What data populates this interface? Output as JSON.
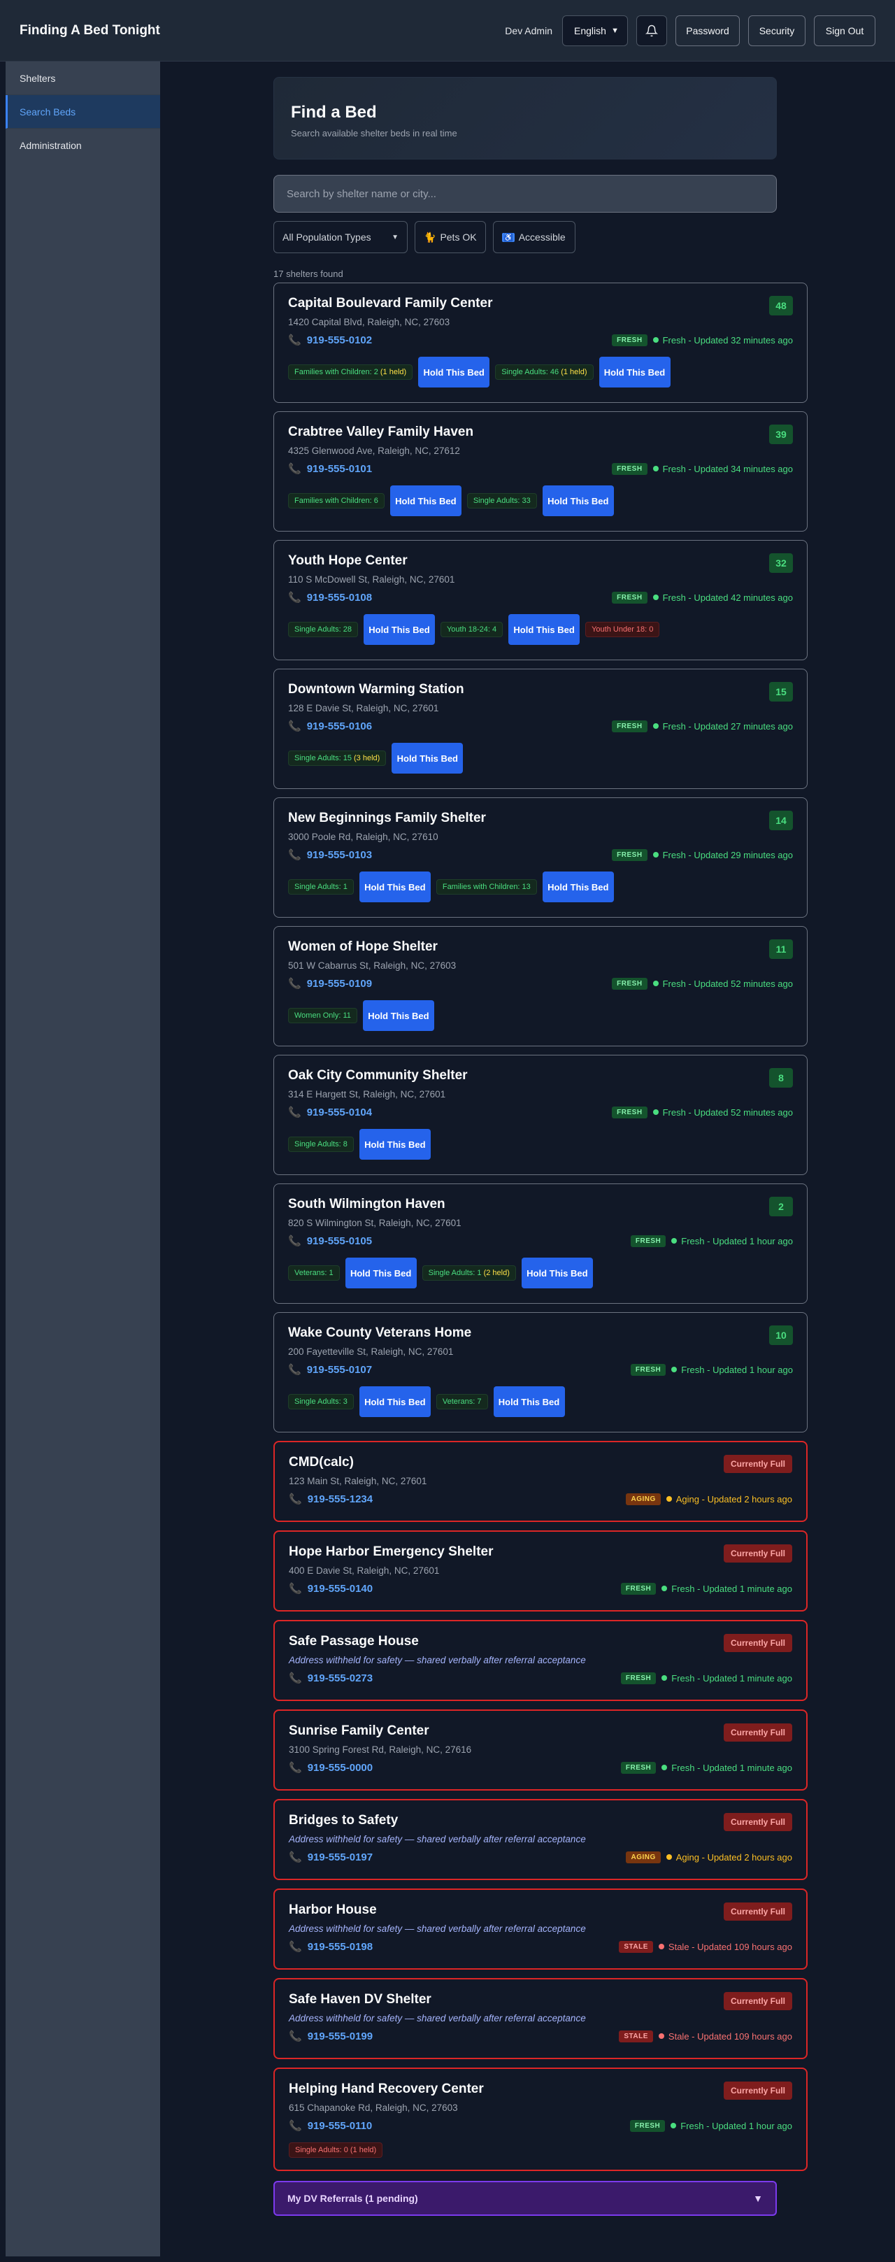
{
  "app": {
    "title": "Finding A Bed Tonight"
  },
  "header": {
    "user": "Dev Admin",
    "language": "English",
    "password_label": "Password",
    "security_label": "Security",
    "signout_label": "Sign Out"
  },
  "sidebar": {
    "items": [
      {
        "label": "Shelters"
      },
      {
        "label": "Search Beds"
      },
      {
        "label": "Administration"
      }
    ]
  },
  "page": {
    "title": "Find a Bed",
    "subtitle": "Search available shelter beds in real time",
    "search_placeholder": "Search by shelter name or city...",
    "filter_population": "All Population Types",
    "filter_pets": "Pets OK",
    "filter_accessible": "Accessible",
    "results_count": "17 shelters found"
  },
  "shelters": [
    {
      "name": "Capital Boulevard Family Center",
      "address": "1420 Capital Blvd, Raleigh, NC, 27603",
      "phone": "919-555-0102",
      "badge": "FRESH",
      "updated": "Fresh - Updated 32 minutes ago",
      "count": "48"
    },
    {
      "name": "Crabtree Valley Family Haven",
      "address": "4325 Glenwood Ave, Raleigh, NC, 27612",
      "phone": "919-555-0101",
      "badge": "FRESH",
      "updated": "Fresh - Updated 34 minutes ago",
      "count": "39"
    },
    {
      "name": "Youth Hope Center",
      "address": "110 S McDowell St, Raleigh, NC, 27601",
      "phone": "919-555-0108",
      "badge": "FRESH",
      "updated": "Fresh - Updated 42 minutes ago",
      "count": "32"
    },
    {
      "name": "Downtown Warming Station",
      "address": "128 E Davie St, Raleigh, NC, 27601",
      "phone": "919-555-0106",
      "badge": "FRESH",
      "updated": "Fresh - Updated 27 minutes ago",
      "count": "15"
    },
    {
      "name": "New Beginnings Family Shelter",
      "address": "3000 Poole Rd, Raleigh, NC, 27610",
      "phone": "919-555-0103",
      "badge": "FRESH",
      "updated": "Fresh - Updated 29 minutes ago",
      "count": "14"
    },
    {
      "name": "Women of Hope Shelter",
      "address": "501 W Cabarrus St, Raleigh, NC, 27603",
      "phone": "919-555-0109",
      "badge": "FRESH",
      "updated": "Fresh - Updated 52 minutes ago",
      "count": "11"
    },
    {
      "name": "Oak City Community Shelter",
      "address": "314 E Hargett St, Raleigh, NC, 27601",
      "phone": "919-555-0104",
      "badge": "FRESH",
      "updated": "Fresh - Updated 52 minutes ago",
      "count": "8"
    },
    {
      "name": "South Wilmington Haven",
      "address": "820 S Wilmington St, Raleigh, NC, 27601",
      "phone": "919-555-0105",
      "badge": "FRESH",
      "updated": "Fresh - Updated 1 hour ago",
      "count": "2"
    },
    {
      "name": "Wake County Veterans Home",
      "address": "200 Fayetteville St, Raleigh, NC, 27601",
      "phone": "919-555-0107",
      "badge": "FRESH",
      "updated": "Fresh - Updated 1 hour ago",
      "count": "10"
    },
    {
      "name": "CMD(calc)",
      "address": "123 Main St, Raleigh, NC, 27601",
      "phone": "919-555-1234",
      "badge": "AGING",
      "updated": "Aging - Updated 2 hours ago",
      "full": "Currently Full"
    },
    {
      "name": "Hope Harbor Emergency Shelter",
      "address": "400 E Davie St, Raleigh, NC, 27601",
      "phone": "919-555-0140",
      "badge": "FRESH",
      "updated": "Fresh - Updated 1 minute ago",
      "full": "Currently Full"
    },
    {
      "name": "Safe Passage House",
      "address": "Address withheld for safety — shared verbally after referral acceptance",
      "phone": "919-555-0273",
      "badge": "FRESH",
      "updated": "Fresh - Updated 1 minute ago",
      "full": "Currently Full"
    },
    {
      "name": "Sunrise Family Center",
      "address": "3100 Spring Forest Rd, Raleigh, NC, 27616",
      "phone": "919-555-0000",
      "badge": "FRESH",
      "updated": "Fresh - Updated 1 minute ago",
      "full": "Currently Full"
    },
    {
      "name": "Bridges to Safety",
      "address": "Address withheld for safety — shared verbally after referral acceptance",
      "phone": "919-555-0197",
      "badge": "AGING",
      "updated": "Aging - Updated 2 hours ago",
      "full": "Currently Full"
    },
    {
      "name": "Harbor House",
      "address": "Address withheld for safety — shared verbally after referral acceptance",
      "phone": "919-555-0198",
      "badge": "STALE",
      "updated": "Stale - Updated 109 hours ago",
      "full": "Currently Full"
    },
    {
      "name": "Safe Haven DV Shelter",
      "address": "Address withheld for safety — shared verbally after referral acceptance",
      "phone": "919-555-0199",
      "badge": "STALE",
      "updated": "Stale - Updated 109 hours ago",
      "full": "Currently Full"
    },
    {
      "name": "Helping Hand Recovery Center",
      "address": "615 Chapanoke Rd, Raleigh, NC, 27603",
      "phone": "919-555-0110",
      "badge": "FRESH",
      "updated": "Fresh - Updated 1 hour ago",
      "full": "Currently Full"
    }
  ],
  "beds": {
    "c0a": "Families with Children: 2",
    "c0a_held": "(1 held)",
    "c0b": "Single Adults: 46",
    "c0b_held": "(1 held)",
    "c1a": "Families with Children: 6",
    "c1b": "Single Adults: 33",
    "c2a": "Single Adults: 28",
    "c2b": "Youth 18-24: 4",
    "c2c": "Youth Under 18: 0",
    "c3a": "Single Adults: 15",
    "c3a_held": "(3 held)",
    "c4a": "Single Adults: 1",
    "c4b": "Families with Children: 13",
    "c5a": "Women Only: 11",
    "c6a": "Single Adults: 8",
    "c7a": "Veterans: 1",
    "c7b": "Single Adults: 1",
    "c7b_held": "(2 held)",
    "c8a": "Single Adults: 3",
    "c8b": "Veterans: 7",
    "c16a": "Single Adults: 0 (1 held)",
    "hold_label": "Hold This Bed"
  },
  "dv_referrals": {
    "label": "My DV Referrals (1 pending)"
  },
  "colors": {
    "accent": "#2563eb",
    "fresh": "#4ade80",
    "aging": "#fbbf24",
    "stale": "#f87171",
    "full_border": "#dc2626"
  }
}
